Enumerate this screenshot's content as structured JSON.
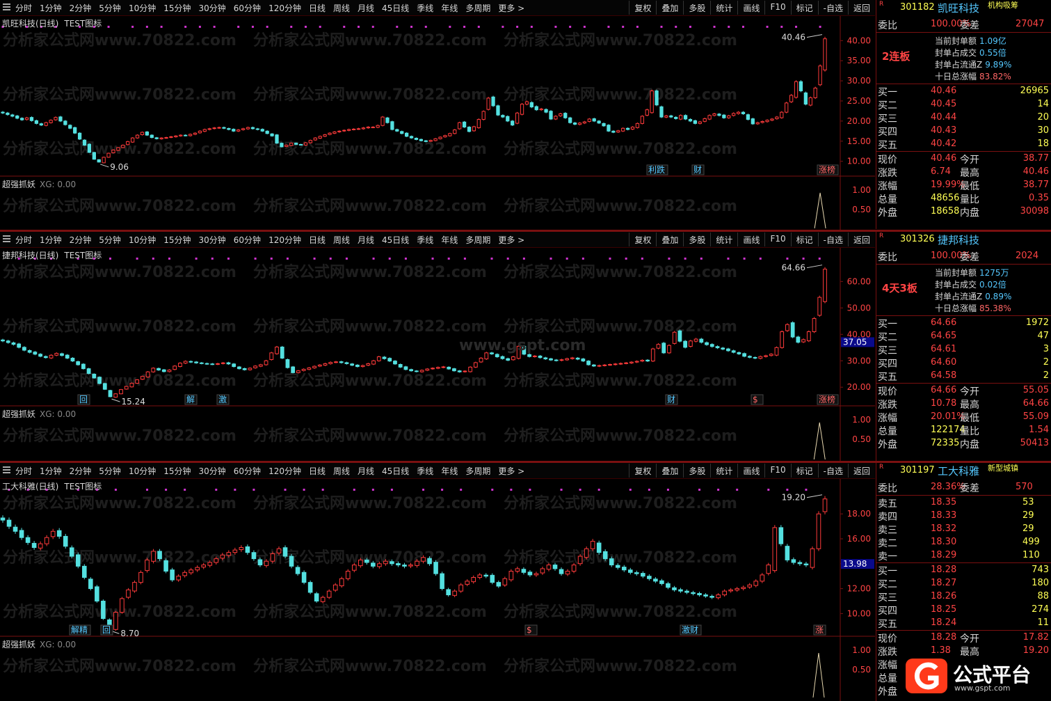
{
  "toolbar": {
    "periods": [
      "分时",
      "1分钟",
      "2分钟",
      "5分钟",
      "10分钟",
      "15分钟",
      "30分钟",
      "60分钟",
      "120分钟",
      "日线",
      "周线",
      "月线",
      "45日线",
      "季线",
      "年线",
      "多周期",
      "更多 >"
    ],
    "buttons": [
      "复权",
      "叠加",
      "多股",
      "统计",
      "画线",
      "F10",
      "标记",
      "-自选",
      "返回"
    ]
  },
  "watermark": "分析家公式网www.70822.com",
  "watermark_site": "www.gspt.com",
  "colors": {
    "up": "#ff3b3b",
    "down": "#54e0e0",
    "bg": "#000000",
    "grid": "#7a1010",
    "marker": "#cc33cc"
  },
  "panels": [
    {
      "title": "凯旺科技(日线)",
      "indicator": "TEST图标",
      "sub_title": "超强抓妖",
      "sub_value": "XG: 0.00",
      "price_axis": [
        "40.00",
        "35.00",
        "30.00",
        "25.00",
        "20.00",
        "15.00",
        "10.00"
      ],
      "price_range": [
        7,
        43
      ],
      "sub_axis": [
        "1.00",
        "0.50"
      ],
      "high_label": "40.46",
      "low_label": "9.06",
      "events": [
        "利跌",
        "财",
        "涨榜"
      ],
      "closes": [
        22.0,
        21.6,
        21.2,
        20.7,
        20.3,
        20.8,
        20.1,
        19.4,
        19.0,
        19.6,
        20.2,
        20.9,
        20.0,
        19.1,
        18.2,
        17.0,
        15.5,
        14.0,
        12.2,
        10.5,
        9.8,
        11.0,
        12.0,
        12.8,
        13.4,
        14.0,
        14.9,
        15.8,
        16.5,
        17.2,
        16.5,
        15.9,
        15.6,
        15.8,
        15.9,
        16.1,
        16.3,
        16.5,
        16.4,
        16.7,
        17.0,
        17.5,
        17.9,
        18.1,
        18.3,
        18.4,
        18.2,
        17.9,
        17.5,
        17.8,
        18.1,
        18.4,
        18.1,
        17.9,
        17.5,
        16.9,
        16.3,
        14.5,
        13.6,
        14.0,
        14.5,
        14.2,
        14.1,
        14.6,
        15.2,
        15.8,
        16.2,
        16.6,
        17.0,
        17.3,
        17.5,
        17.7,
        17.9,
        18.0,
        18.1,
        18.3,
        18.5,
        18.5,
        18.9,
        21.0,
        19.6,
        17.9,
        17.5,
        16.9,
        16.2,
        15.8,
        15.4,
        15.1,
        14.9,
        15.2,
        15.6,
        16.0,
        16.4,
        16.9,
        17.8,
        19.6,
        18.5,
        17.4,
        18.6,
        20.4,
        22.4,
        25.7,
        23.8,
        21.5,
        21.0,
        20.0,
        19.0,
        22.0,
        24.2,
        24.8,
        23.5,
        22.8,
        23.0,
        22.2,
        20.5,
        21.2,
        21.8,
        20.8,
        19.6,
        19.2,
        19.5,
        19.8,
        20.5,
        20.0,
        19.5,
        18.8,
        17.5,
        17.2,
        17.6,
        18.2,
        17.9,
        18.5,
        19.4,
        21.2,
        22.8,
        27.5,
        24.0,
        21.0,
        21.3,
        21.0,
        20.6,
        21.4,
        20.5,
        20.0,
        19.4,
        19.8,
        20.6,
        21.4,
        21.8,
        21.4,
        20.8,
        21.3,
        21.9,
        22.2,
        21.8,
        20.4,
        19.3,
        19.6,
        19.9,
        20.2,
        20.5,
        21.0,
        22.2,
        24.5,
        26.4,
        29.8,
        27.5,
        24.2,
        25.8,
        28.2,
        33.7,
        40.46
      ]
    },
    {
      "title": "捷邦科技(日线)",
      "indicator": "TEST图标",
      "sub_title": "超强抓妖",
      "sub_value": "XG: 0.00",
      "price_axis": [
        "60.00",
        "50.00",
        "40.00",
        "30.00",
        "20.00"
      ],
      "price_range": [
        14,
        68
      ],
      "sub_axis": [
        "1.00",
        "0.50"
      ],
      "side_price_tag": "37.05",
      "high_label": "64.66",
      "low_label": "15.24",
      "events": [
        "回",
        "解",
        "激",
        "财",
        "$",
        "涨榜"
      ],
      "closes": [
        37.5,
        36.9,
        36.2,
        35.1,
        34.0,
        33.2,
        32.5,
        31.7,
        31.2,
        32.1,
        32.8,
        32.0,
        31.0,
        29.9,
        28.5,
        27.0,
        25.2,
        23.5,
        21.4,
        19.2,
        16.4,
        17.5,
        19.1,
        20.3,
        21.5,
        22.8,
        24.1,
        25.8,
        27.2,
        26.5,
        25.9,
        26.5,
        28.0,
        29.1,
        29.8,
        29.5,
        29.2,
        29.0,
        28.8,
        28.7,
        28.9,
        29.2,
        28.8,
        27.8,
        27.0,
        26.6,
        27.2,
        28.0,
        28.5,
        30.0,
        33.0,
        35.2,
        31.0,
        27.4,
        25.5,
        26.2,
        26.8,
        27.3,
        27.9,
        28.4,
        28.9,
        29.4,
        29.6,
        29.3,
        28.9,
        28.3,
        27.8,
        28.2,
        28.9,
        30.0,
        31.5,
        30.8,
        29.9,
        28.8,
        27.6,
        26.7,
        26.2,
        25.9,
        26.4,
        26.9,
        27.2,
        27.5,
        27.7,
        26.9,
        26.2,
        25.8,
        26.1,
        27.6,
        29.3,
        31.0,
        33.0,
        32.6,
        31.5,
        30.8,
        30.2,
        31.5,
        35.5,
        32.5,
        31.6,
        31.8,
        31.2,
        30.7,
        30.3,
        30.1,
        30.4,
        30.8,
        31.1,
        30.6,
        29.9,
        28.5,
        28.0,
        28.2,
        28.4,
        28.6,
        28.8,
        29.0,
        29.2,
        29.5,
        29.8,
        30.2,
        29.9,
        34.5,
        36.2,
        33.0,
        35.8,
        40.8,
        37.4,
        35.1,
        37.5,
        38.2,
        37.0,
        36.1,
        35.4,
        34.9,
        34.4,
        33.8,
        33.2,
        32.6,
        31.7,
        31.3,
        31.0,
        31.6,
        31.9,
        32.5,
        35.0,
        41.0,
        43.7,
        39.0,
        37.0,
        38.0,
        41.0,
        46.0,
        54.0,
        64.66
      ]
    },
    {
      "title": "工大科雅(日线)",
      "indicator": "TEST图标",
      "sub_title": "超强抓妖",
      "sub_value": "XG: 0.00",
      "price_axis": [
        "18.00",
        "16.00",
        "14.00",
        "12.00",
        "10.00"
      ],
      "price_range": [
        8.4,
        19.8
      ],
      "sub_axis": [
        "1.00",
        "0.50"
      ],
      "side_price_tag": "13.98",
      "high_label": "19.20",
      "low_label": "8.70",
      "events": [
        "解精",
        "回",
        "$",
        "激财",
        "涨"
      ],
      "closes": [
        17.5,
        17.0,
        16.6,
        16.1,
        15.7,
        15.3,
        15.6,
        16.1,
        16.6,
        16.2,
        15.4,
        14.6,
        13.8,
        12.9,
        12.0,
        11.0,
        9.6,
        8.9,
        10.1,
        11.2,
        11.9,
        12.5,
        13.3,
        14.3,
        15.0,
        14.4,
        13.4,
        12.7,
        13.0,
        13.3,
        13.5,
        13.7,
        13.9,
        14.1,
        14.4,
        14.7,
        14.9,
        15.1,
        15.3,
        14.9,
        14.4,
        13.9,
        14.2,
        14.8,
        15.2,
        14.6,
        13.8,
        13.2,
        12.5,
        11.7,
        11.0,
        11.3,
        11.8,
        12.3,
        12.8,
        13.4,
        13.9,
        14.3,
        14.1,
        13.8,
        14.0,
        14.2,
        14.0,
        13.9,
        13.8,
        13.9,
        14.2,
        14.5,
        14.0,
        13.2,
        12.0,
        11.5,
        11.8,
        12.3,
        12.6,
        12.9,
        13.1,
        13.0,
        12.5,
        12.2,
        12.8,
        13.4,
        13.6,
        13.3,
        13.1,
        13.2,
        13.6,
        13.9,
        13.6,
        13.2,
        13.4,
        13.9,
        14.6,
        15.2,
        15.8,
        14.9,
        14.4,
        13.9,
        13.7,
        13.5,
        13.3,
        13.2,
        13.0,
        12.8,
        12.6,
        12.4,
        12.1,
        11.9,
        11.8,
        11.7,
        11.6,
        11.5,
        11.4,
        11.3,
        11.5,
        11.8,
        11.9,
        12.0,
        12.1,
        12.3,
        12.6,
        13.1,
        13.9,
        16.9,
        15.6,
        14.3,
        14.1,
        14.0,
        13.9,
        15.2,
        18.0,
        19.2
      ]
    }
  ],
  "sides": [
    {
      "code": "301182",
      "name": "凯旺科技",
      "tag": "机构吸筹",
      "weibi_label": "委比",
      "weibi": "100.00%",
      "weicha_label": "委差",
      "weicha": "27047",
      "board": "2连板",
      "seal": [
        [
          "当前封单额",
          "1.09亿"
        ],
        [
          "封单占成交",
          "0.55倍"
        ],
        [
          "封单占流通Z",
          "9.89%"
        ],
        [
          "十日总涨幅",
          "83.82%"
        ]
      ],
      "book": [
        [
          "买一",
          "40.46",
          "26965"
        ],
        [
          "买二",
          "40.45",
          "14"
        ],
        [
          "买三",
          "40.44",
          "20"
        ],
        [
          "买四",
          "40.43",
          "30"
        ],
        [
          "买五",
          "40.42",
          "18"
        ]
      ],
      "stats": [
        [
          "现价",
          "40.46",
          "今开",
          "38.77"
        ],
        [
          "涨跌",
          "6.74",
          "最高",
          "40.46"
        ],
        [
          "涨幅",
          "19.99%",
          "最低",
          "38.77"
        ],
        [
          "总量",
          "48656",
          "量比",
          "0.35"
        ],
        [
          "外盘",
          "18658",
          "内盘",
          "30098"
        ]
      ]
    },
    {
      "code": "301326",
      "name": "捷邦科技",
      "tag": "",
      "weibi_label": "委比",
      "weibi": "100.00%",
      "weicha_label": "委差",
      "weicha": "2024",
      "board": "4天3板",
      "seal": [
        [
          "当前封单额",
          "1275万"
        ],
        [
          "封单占成交",
          "0.02倍"
        ],
        [
          "封单占流通Z",
          "0.89%"
        ],
        [
          "十日总涨幅",
          "85.38%"
        ]
      ],
      "book": [
        [
          "买一",
          "64.66",
          "1972"
        ],
        [
          "买二",
          "64.65",
          "47"
        ],
        [
          "买三",
          "64.61",
          "3"
        ],
        [
          "买四",
          "64.60",
          "2"
        ],
        [
          "买五",
          "64.58",
          "2"
        ]
      ],
      "stats": [
        [
          "现价",
          "64.66",
          "今开",
          "55.05"
        ],
        [
          "涨跌",
          "10.78",
          "最高",
          "64.66"
        ],
        [
          "涨幅",
          "20.01%",
          "最低",
          "55.09"
        ],
        [
          "总量",
          "122174",
          "量比",
          "1.54"
        ],
        [
          "外盘",
          "72335",
          "内盘",
          "50413"
        ]
      ]
    },
    {
      "code": "301197",
      "name": "工大科雅",
      "tag": "新型城镇",
      "weibi_label": "委比",
      "weibi": "28.36%",
      "weicha_label": "委差",
      "weicha": "570",
      "asks": [
        [
          "卖五",
          "18.35",
          "53"
        ],
        [
          "卖四",
          "18.33",
          "29"
        ],
        [
          "卖三",
          "18.32",
          "29"
        ],
        [
          "卖二",
          "18.30",
          "499"
        ],
        [
          "卖一",
          "18.29",
          "110"
        ]
      ],
      "book": [
        [
          "买一",
          "18.28",
          "743"
        ],
        [
          "买二",
          "18.27",
          "180"
        ],
        [
          "买三",
          "18.26",
          "88"
        ],
        [
          "买四",
          "18.25",
          "274"
        ],
        [
          "买五",
          "18.24",
          "11"
        ]
      ],
      "stats": [
        [
          "现价",
          "18.28",
          "今开",
          "17.82"
        ],
        [
          "涨跌",
          "1.38",
          "最高",
          "19.20"
        ],
        [
          "涨幅",
          "",
          "",
          " "
        ],
        [
          "总量",
          "",
          "",
          ""
        ],
        [
          "外盘",
          "",
          "",
          ""
        ]
      ]
    }
  ],
  "logo": {
    "text": "公式平台",
    "url": "www.gspt.com"
  }
}
